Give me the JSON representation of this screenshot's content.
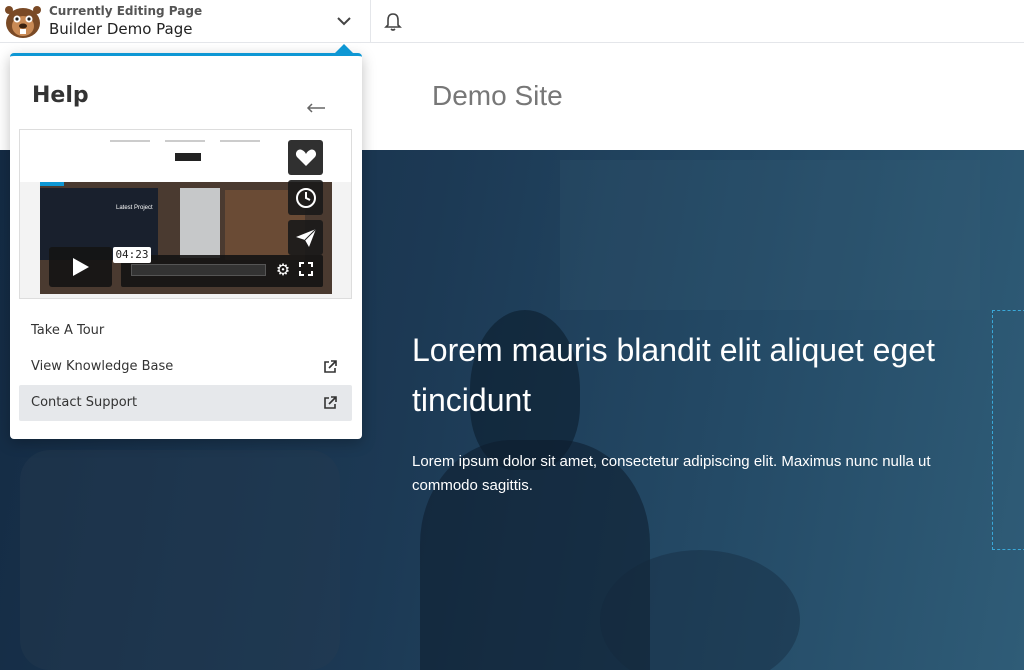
{
  "topbar": {
    "caption": "Currently Editing Page",
    "page_title": "Builder Demo Page"
  },
  "site": {
    "title": "Demo Site",
    "hero_heading": "Lorem mauris blandit elit aliquet eget tincidunt",
    "hero_text": "Lorem ipsum dolor sit amet, consectetur adipiscing elit. Maximus nunc nulla ut commodo sagittis."
  },
  "help": {
    "title": "Help",
    "video": {
      "time": "04:23",
      "preview_title": "Latest Project",
      "progress": 0.0
    },
    "menu": [
      {
        "label": "Take A Tour",
        "external": false
      },
      {
        "label": "View Knowledge Base",
        "external": true
      },
      {
        "label": "Contact Support",
        "external": true,
        "active": true
      }
    ]
  },
  "colors": {
    "accent": "#0e97d4",
    "hero_dark": "#142b44",
    "menu_active_bg": "#e6e8eb"
  },
  "icons": [
    "logo-beaver-icon",
    "chevron-down-icon",
    "bell-icon",
    "arrow-left-icon",
    "play-icon",
    "gear-icon",
    "fullscreen-icon",
    "heart-icon",
    "clock-icon",
    "paper-plane-icon",
    "external-link-icon"
  ]
}
